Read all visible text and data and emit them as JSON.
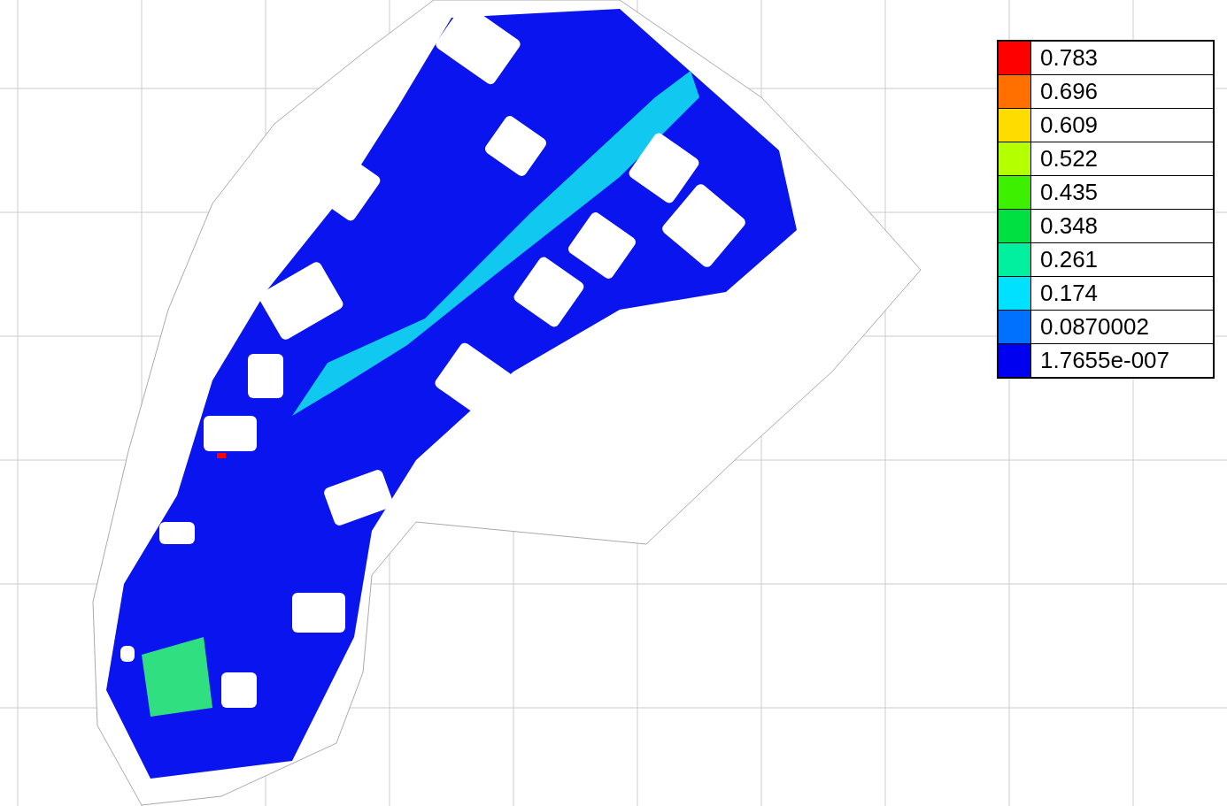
{
  "legend": [
    {
      "label": "0.783",
      "color": "#ff0000"
    },
    {
      "label": "0.696",
      "color": "#ff7000"
    },
    {
      "label": "0.609",
      "color": "#ffdc00"
    },
    {
      "label": "0.522",
      "color": "#b4ff00"
    },
    {
      "label": "0.435",
      "color": "#3cf000"
    },
    {
      "label": "0.348",
      "color": "#00e040"
    },
    {
      "label": "0.261",
      "color": "#00f0a0"
    },
    {
      "label": "0.174",
      "color": "#00e0ff"
    },
    {
      "label": "0.0870002",
      "color": "#0070ff"
    },
    {
      "label": "1.7655e-007",
      "color": "#0000f0"
    }
  ]
}
